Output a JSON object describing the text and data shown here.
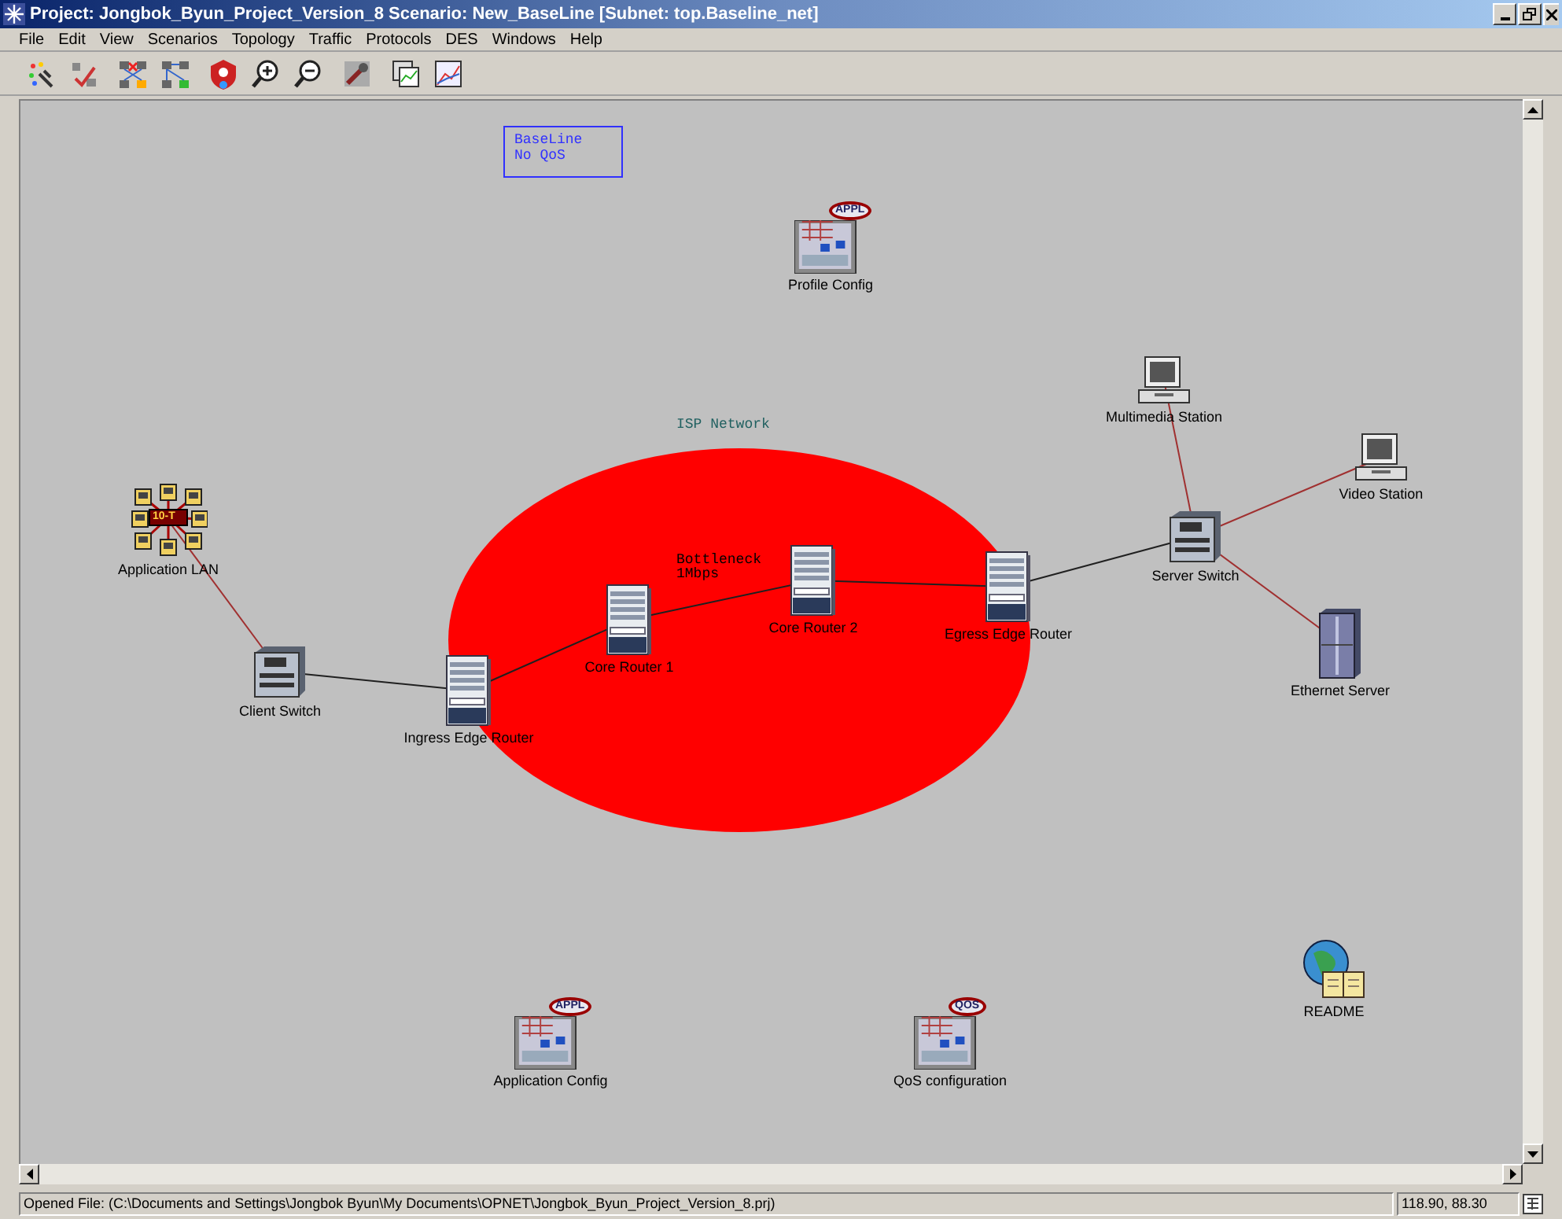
{
  "window": {
    "title": "Project: Jongbok_Byun_Project_Version_8 Scenario: New_BaseLine  [Subnet: top.Baseline_net]"
  },
  "menu": [
    "File",
    "Edit",
    "View",
    "Scenarios",
    "Topology",
    "Traffic",
    "Protocols",
    "DES",
    "Windows",
    "Help"
  ],
  "toolbar": [
    {
      "kind": "nodes"
    },
    {
      "kind": "verify"
    },
    {
      "kind": "fail"
    },
    {
      "kind": "recover"
    },
    {
      "kind": "run"
    },
    {
      "kind": "zoomin"
    },
    {
      "kind": "zoomout"
    },
    {
      "kind": "edit"
    },
    {
      "kind": "results"
    },
    {
      "kind": "graph"
    }
  ],
  "canvas": {
    "annotation": {
      "lines": [
        "BaseLine",
        "No QoS"
      ]
    },
    "region": {
      "label": "ISP Network",
      "color": "#ff0000"
    },
    "link_note": {
      "lines": [
        "Bottleneck",
        "1Mbps"
      ]
    },
    "nodes": [
      {
        "kind": "config",
        "label": "Profile Config",
        "badge": "APPL"
      },
      {
        "kind": "workstation",
        "label": "Multimedia Station"
      },
      {
        "kind": "workstation",
        "label": "Video Station"
      },
      {
        "kind": "lan",
        "label": "Application LAN",
        "badge": "10-T"
      },
      {
        "kind": "switch",
        "label": "Server Switch"
      },
      {
        "kind": "server",
        "label": "Ethernet Server"
      },
      {
        "kind": "switch",
        "label": "Client Switch"
      },
      {
        "kind": "router",
        "label": "Ingress Edge Router"
      },
      {
        "kind": "router",
        "label": "Core Router 1"
      },
      {
        "kind": "router",
        "label": "Core Router 2"
      },
      {
        "kind": "router",
        "label": "Egress Edge Router"
      },
      {
        "kind": "config",
        "label": "Application Config",
        "badge": "APPL"
      },
      {
        "kind": "config",
        "label": "QoS configuration",
        "badge": "QOS"
      },
      {
        "kind": "readme",
        "label": "README"
      }
    ],
    "links": [
      {
        "color": "#a03030"
      },
      {
        "color": "#202020"
      },
      {
        "color": "#202020"
      },
      {
        "color": "#202020"
      },
      {
        "color": "#202020"
      },
      {
        "color": "#202020"
      },
      {
        "color": "#a03030"
      },
      {
        "color": "#a03030"
      },
      {
        "color": "#a03030"
      }
    ]
  },
  "status_bar": {
    "message": "Opened File: (C:\\Documents and Settings\\Jongbok Byun\\My Documents\\OPNET\\Jongbok_Byun_Project_Version_8.prj)",
    "coordinates": "118.90, 88.30"
  }
}
